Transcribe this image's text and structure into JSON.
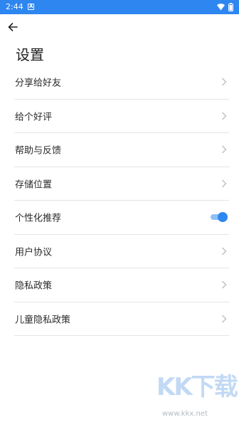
{
  "status_bar": {
    "time": "2:44",
    "app_icon_letter": "A",
    "background_color": "#2e86f0"
  },
  "header": {
    "back_icon": "arrow-left-icon",
    "title": "设置"
  },
  "settings": [
    {
      "label": "分享给好友",
      "control": "chevron"
    },
    {
      "label": "给个好评",
      "control": "chevron"
    },
    {
      "label": "帮助与反馈",
      "control": "chevron"
    },
    {
      "label": "存储位置",
      "control": "chevron"
    },
    {
      "label": "个性化推荐",
      "control": "toggle",
      "toggle_on": true
    },
    {
      "label": "用户协议",
      "control": "chevron"
    },
    {
      "label": "隐私政策",
      "control": "chevron"
    },
    {
      "label": "儿童隐私政策",
      "control": "chevron"
    }
  ],
  "colors": {
    "accent": "#2e86f0",
    "chevron": "#bdbdbd",
    "divider": "#e4e4e4"
  },
  "watermark": {
    "logo": "KK下载",
    "url": "www.kkx.net"
  }
}
